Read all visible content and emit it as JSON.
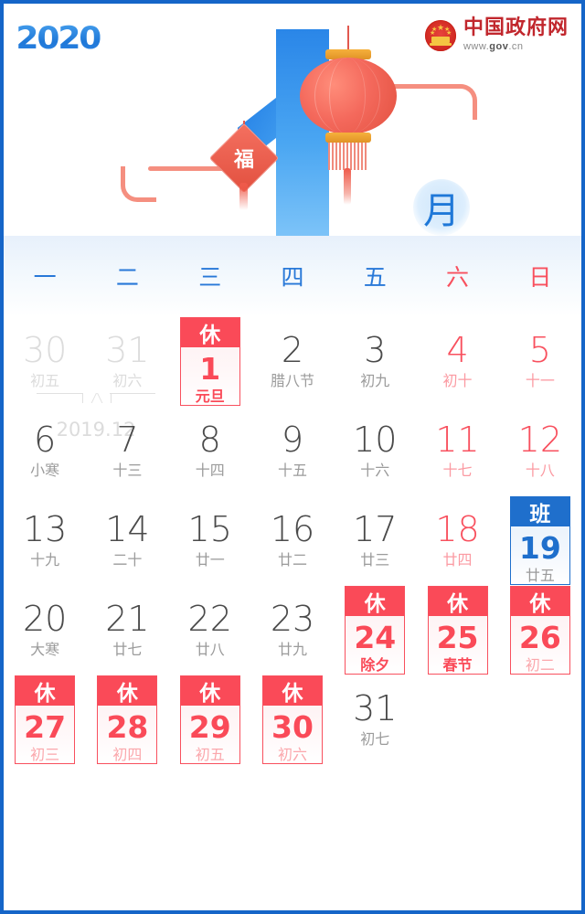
{
  "header": {
    "year_logo": "2020",
    "site_name": "中国政府网",
    "site_url_prefix": "www.",
    "site_url_mid": "gov",
    "site_url_suffix": ".cn",
    "month_glyph": "月",
    "hero_numeral": "1",
    "fu_char": "福",
    "accent_blue": "#1f6fcc",
    "accent_red": "#fa4a58",
    "border_blue": "#1565C8"
  },
  "weekdays": [
    {
      "label": "一",
      "weekend": false
    },
    {
      "label": "二",
      "weekend": false
    },
    {
      "label": "三",
      "weekend": false
    },
    {
      "label": "四",
      "weekend": false
    },
    {
      "label": "五",
      "weekend": false
    },
    {
      "label": "六",
      "weekend": true
    },
    {
      "label": "日",
      "weekend": true
    }
  ],
  "prev_month": {
    "label": "2019.12"
  },
  "weeks": [
    [
      {
        "num": "30",
        "lunar": "初五",
        "style": "muted",
        "badge": null
      },
      {
        "num": "31",
        "lunar": "初六",
        "style": "muted",
        "badge": null
      },
      {
        "num": "1",
        "lunar": "元旦",
        "style": "rest",
        "badge": "休"
      },
      {
        "num": "2",
        "lunar": "腊八节",
        "style": "normal",
        "badge": null
      },
      {
        "num": "3",
        "lunar": "初九",
        "style": "normal",
        "badge": null
      },
      {
        "num": "4",
        "lunar": "初十",
        "style": "red",
        "badge": null
      },
      {
        "num": "5",
        "lunar": "十一",
        "style": "red",
        "badge": null
      }
    ],
    [
      {
        "num": "6",
        "lunar": "小寒",
        "style": "normal",
        "badge": null
      },
      {
        "num": "7",
        "lunar": "十三",
        "style": "normal",
        "badge": null
      },
      {
        "num": "8",
        "lunar": "十四",
        "style": "normal",
        "badge": null
      },
      {
        "num": "9",
        "lunar": "十五",
        "style": "normal",
        "badge": null
      },
      {
        "num": "10",
        "lunar": "十六",
        "style": "normal",
        "badge": null
      },
      {
        "num": "11",
        "lunar": "十七",
        "style": "red",
        "badge": null
      },
      {
        "num": "12",
        "lunar": "十八",
        "style": "red",
        "badge": null
      }
    ],
    [
      {
        "num": "13",
        "lunar": "十九",
        "style": "normal",
        "badge": null
      },
      {
        "num": "14",
        "lunar": "二十",
        "style": "normal",
        "badge": null
      },
      {
        "num": "15",
        "lunar": "廿一",
        "style": "normal",
        "badge": null
      },
      {
        "num": "16",
        "lunar": "廿二",
        "style": "normal",
        "badge": null
      },
      {
        "num": "17",
        "lunar": "廿三",
        "style": "normal",
        "badge": null
      },
      {
        "num": "18",
        "lunar": "廿四",
        "style": "red",
        "badge": null
      },
      {
        "num": "19",
        "lunar": "廿五",
        "style": "work",
        "badge": "班"
      }
    ],
    [
      {
        "num": "20",
        "lunar": "大寒",
        "style": "normal",
        "badge": null
      },
      {
        "num": "21",
        "lunar": "廿七",
        "style": "normal",
        "badge": null
      },
      {
        "num": "22",
        "lunar": "廿八",
        "style": "normal",
        "badge": null
      },
      {
        "num": "23",
        "lunar": "廿九",
        "style": "normal",
        "badge": null
      },
      {
        "num": "24",
        "lunar": "除夕",
        "style": "rest",
        "badge": "休"
      },
      {
        "num": "25",
        "lunar": "春节",
        "style": "rest",
        "badge": "休"
      },
      {
        "num": "26",
        "lunar": "初二",
        "style": "rest-soft",
        "badge": "休"
      }
    ],
    [
      {
        "num": "27",
        "lunar": "初三",
        "style": "rest-soft",
        "badge": "休"
      },
      {
        "num": "28",
        "lunar": "初四",
        "style": "rest-soft",
        "badge": "休"
      },
      {
        "num": "29",
        "lunar": "初五",
        "style": "rest-soft",
        "badge": "休"
      },
      {
        "num": "30",
        "lunar": "初六",
        "style": "rest-soft",
        "badge": "休"
      },
      {
        "num": "31",
        "lunar": "初七",
        "style": "normal",
        "badge": null
      },
      {
        "num": "",
        "lunar": "",
        "style": "empty",
        "badge": null
      },
      {
        "num": "",
        "lunar": "",
        "style": "empty",
        "badge": null
      }
    ]
  ]
}
